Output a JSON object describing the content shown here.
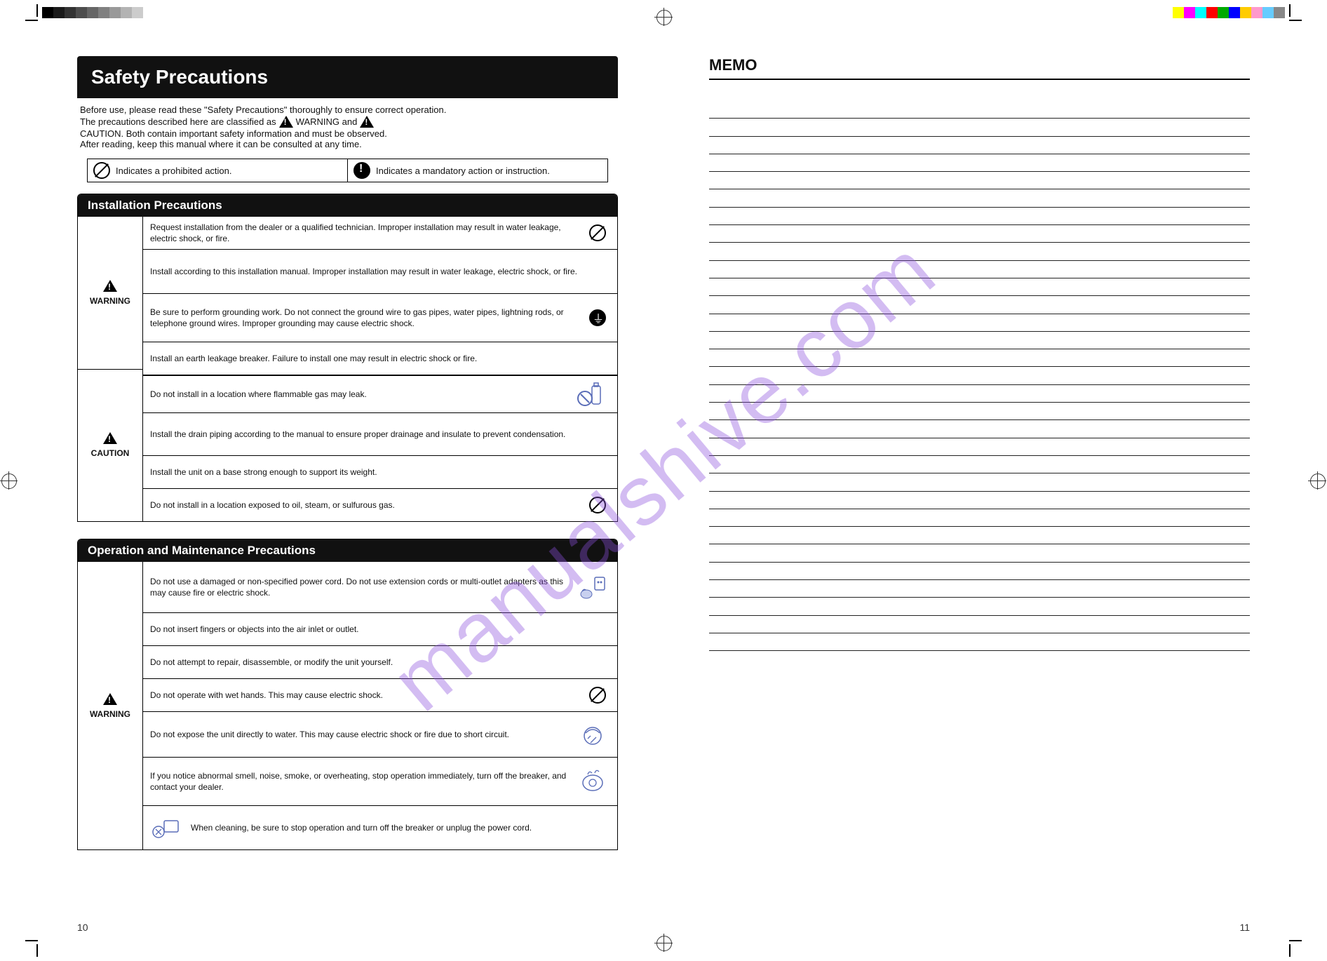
{
  "watermark": "manualshive.com",
  "colorbars": {
    "left": [
      "#000000",
      "#1a1a1a",
      "#333333",
      "#4d4d4d",
      "#666666",
      "#808080",
      "#999999",
      "#b3b3b3",
      "#cccccc",
      "#ffffff"
    ],
    "right": [
      "#ffff00",
      "#ff00ff",
      "#00ffff",
      "#ff0000",
      "#00aa00",
      "#0000ff",
      "#ffcc00",
      "#ff99cc",
      "#66ccff",
      "#888888"
    ]
  },
  "page_numbers": {
    "left": "10",
    "right": "11"
  },
  "left_page": {
    "title": "Safety Precautions",
    "intro_parts": [
      "Before use, please read these \"Safety Precautions\" thoroughly to ensure correct operation.",
      "The precautions described here are classified as",
      "WARNING and",
      "CAUTION. Both contain important safety information and must be observed.",
      "After reading, keep this manual where it can be consulted at any time."
    ],
    "legend": {
      "prohibited": "Indicates a prohibited action.",
      "mandatory": "Indicates a mandatory action or instruction."
    },
    "sections": [
      {
        "heading": "Installation Precautions",
        "groups": [
          {
            "label": "WARNING",
            "rows": [
              {
                "text": "Request installation from the dealer or a qualified technician. Improper installation may result in water leakage, electric shock, or fire.",
                "icon": "prohibit"
              },
              {
                "text": "Install according to this installation manual. Improper installation may result in water leakage, electric shock, or fire.",
                "icon": ""
              },
              {
                "text": "Be sure to perform grounding work. Do not connect the ground wire to gas pipes, water pipes, lightning rods, or telephone ground wires. Improper grounding may cause electric shock.",
                "icon": "ground"
              },
              {
                "text": "Install an earth leakage breaker. Failure to install one may result in electric shock or fire.",
                "icon": ""
              }
            ]
          },
          {
            "label": "CAUTION",
            "rows": [
              {
                "text": "Do not install in a location where flammable gas may leak.",
                "icon": "gas-illus"
              },
              {
                "text": "Install the drain piping according to the manual to ensure proper drainage and insulate to prevent condensation.",
                "icon": ""
              },
              {
                "text": "Install the unit on a base strong enough to support its weight.",
                "icon": ""
              },
              {
                "text": "Do not install in a location exposed to oil, steam, or sulfurous gas.",
                "icon": "prohibit"
              }
            ]
          }
        ]
      },
      {
        "heading": "Operation and Maintenance Precautions",
        "groups": [
          {
            "label": "WARNING",
            "rows": [
              {
                "text": "Do not use a damaged or non-specified power cord. Do not use extension cords or multi-outlet adapters as this may cause fire or electric shock.",
                "icon": "plug-illus"
              },
              {
                "text": "Do not insert fingers or objects into the air inlet or outlet.",
                "icon": ""
              },
              {
                "text": "Do not attempt to repair, disassemble, or modify the unit yourself.",
                "icon": ""
              },
              {
                "text": "Do not operate with wet hands. This may cause electric shock.",
                "icon": "prohibit"
              },
              {
                "text": "Do not expose the unit directly to water. This may cause electric shock or fire due to short circuit.",
                "icon": "water-illus"
              },
              {
                "text": "If you notice abnormal smell, noise, smoke, or overheating, stop operation immediately, turn off the breaker, and contact your dealer.",
                "icon": "smoke-illus"
              },
              {
                "text": "When cleaning, be sure to stop operation and turn off the breaker or unplug the power cord.",
                "icon": "clean-illus"
              }
            ]
          }
        ]
      }
    ]
  },
  "right_page": {
    "title": "MEMO",
    "line_count": 31
  }
}
